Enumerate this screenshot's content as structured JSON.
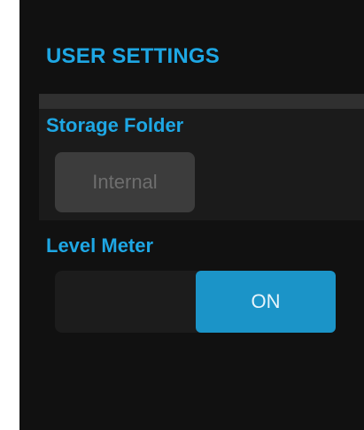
{
  "header": {
    "title": "USER SETTINGS"
  },
  "storage": {
    "label": "Storage Folder",
    "selected_value": "Internal"
  },
  "level_meter": {
    "label": "Level Meter",
    "state_label": "ON",
    "enabled": true
  },
  "colors": {
    "accent": "#1ea7e4",
    "on_button": "#1b94c8",
    "background": "#111111",
    "disabled_button": "#3c3c3c"
  }
}
